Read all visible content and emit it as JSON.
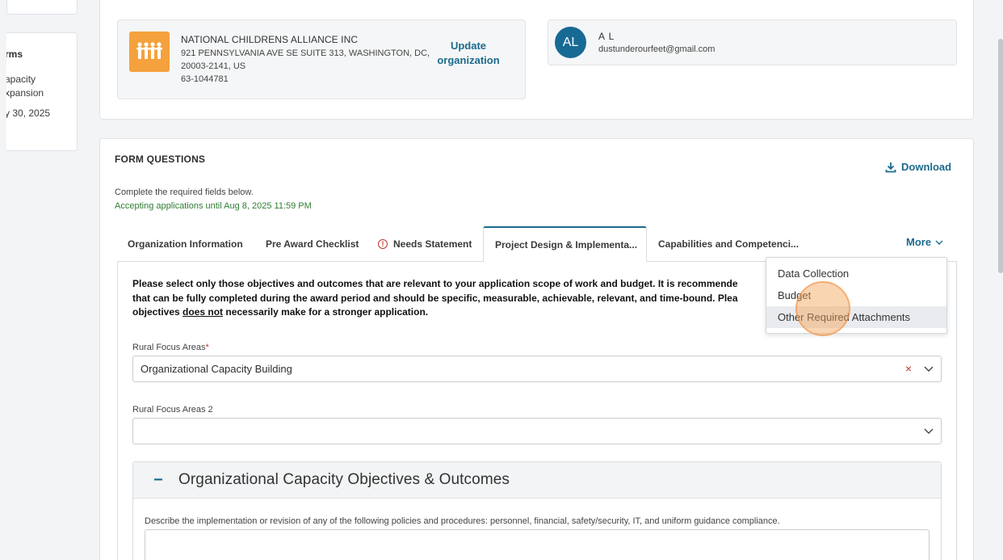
{
  "left_panel": {
    "title": "rms",
    "line1": "apacity",
    "line2": "xpansion",
    "date": "y 30, 2025"
  },
  "organization": {
    "name": "NATIONAL CHILDRENS ALLIANCE INC",
    "address_line1": "921 PENNSYLVANIA AVE SE SUITE 313, WASHINGTON, DC,",
    "address_line2": "20003-2141, US",
    "ein": "63-1044781",
    "update_label_line1": "Update",
    "update_label_line2": "organization",
    "logo_icon": "people-logo-icon"
  },
  "user": {
    "initials": "AL",
    "name": "A L",
    "email": "dustunderourfeet@gmail.com"
  },
  "form": {
    "title": "FORM QUESTIONS",
    "download_label": "Download",
    "instruction": "Complete the required fields below.",
    "accepting": "Accepting applications until Aug 8, 2025 11:59 PM"
  },
  "tabs": [
    {
      "label": "Organization Information"
    },
    {
      "label": "Pre Award Checklist"
    },
    {
      "label": "Needs Statement"
    },
    {
      "label": "Project Design & Implementa..."
    },
    {
      "label": "Capabilities and Competenci..."
    }
  ],
  "more_label": "More",
  "more_menu": [
    {
      "label": "Data Collection"
    },
    {
      "label": "Budget"
    },
    {
      "label": "Other Required Attachments"
    }
  ],
  "notice": {
    "line1": "Please select only those objectives and outcomes that are relevant to your application scope of work and budget. It is recommende",
    "line2": "that can be fully completed during the award period and should be specific, measurable, achievable, relevant, and time-bound. Plea",
    "line3_pre": "objectives ",
    "line3_underlined": "does not",
    "line3_post": " necessarily make for a stronger application."
  },
  "fields": {
    "focus1_label": "Rural Focus Areas",
    "focus1_required": "*",
    "focus1_value": "Organizational Capacity Building",
    "focus1_clear": "×",
    "focus2_label": "Rural Focus Areas 2",
    "focus2_value": ""
  },
  "section": {
    "toggle": "−",
    "title": "Organizational Capacity Objectives & Outcomes",
    "description": "Describe the implementation or revision of any of the following policies and procedures: personnel, financial, safety/security, IT, and uniform guidance compliance."
  },
  "colors": {
    "accent": "#1c6a8c",
    "success": "#2e7d32",
    "danger": "#c0392b",
    "logo_bg": "#f5a13d",
    "avatar_bg": "#176a94"
  }
}
